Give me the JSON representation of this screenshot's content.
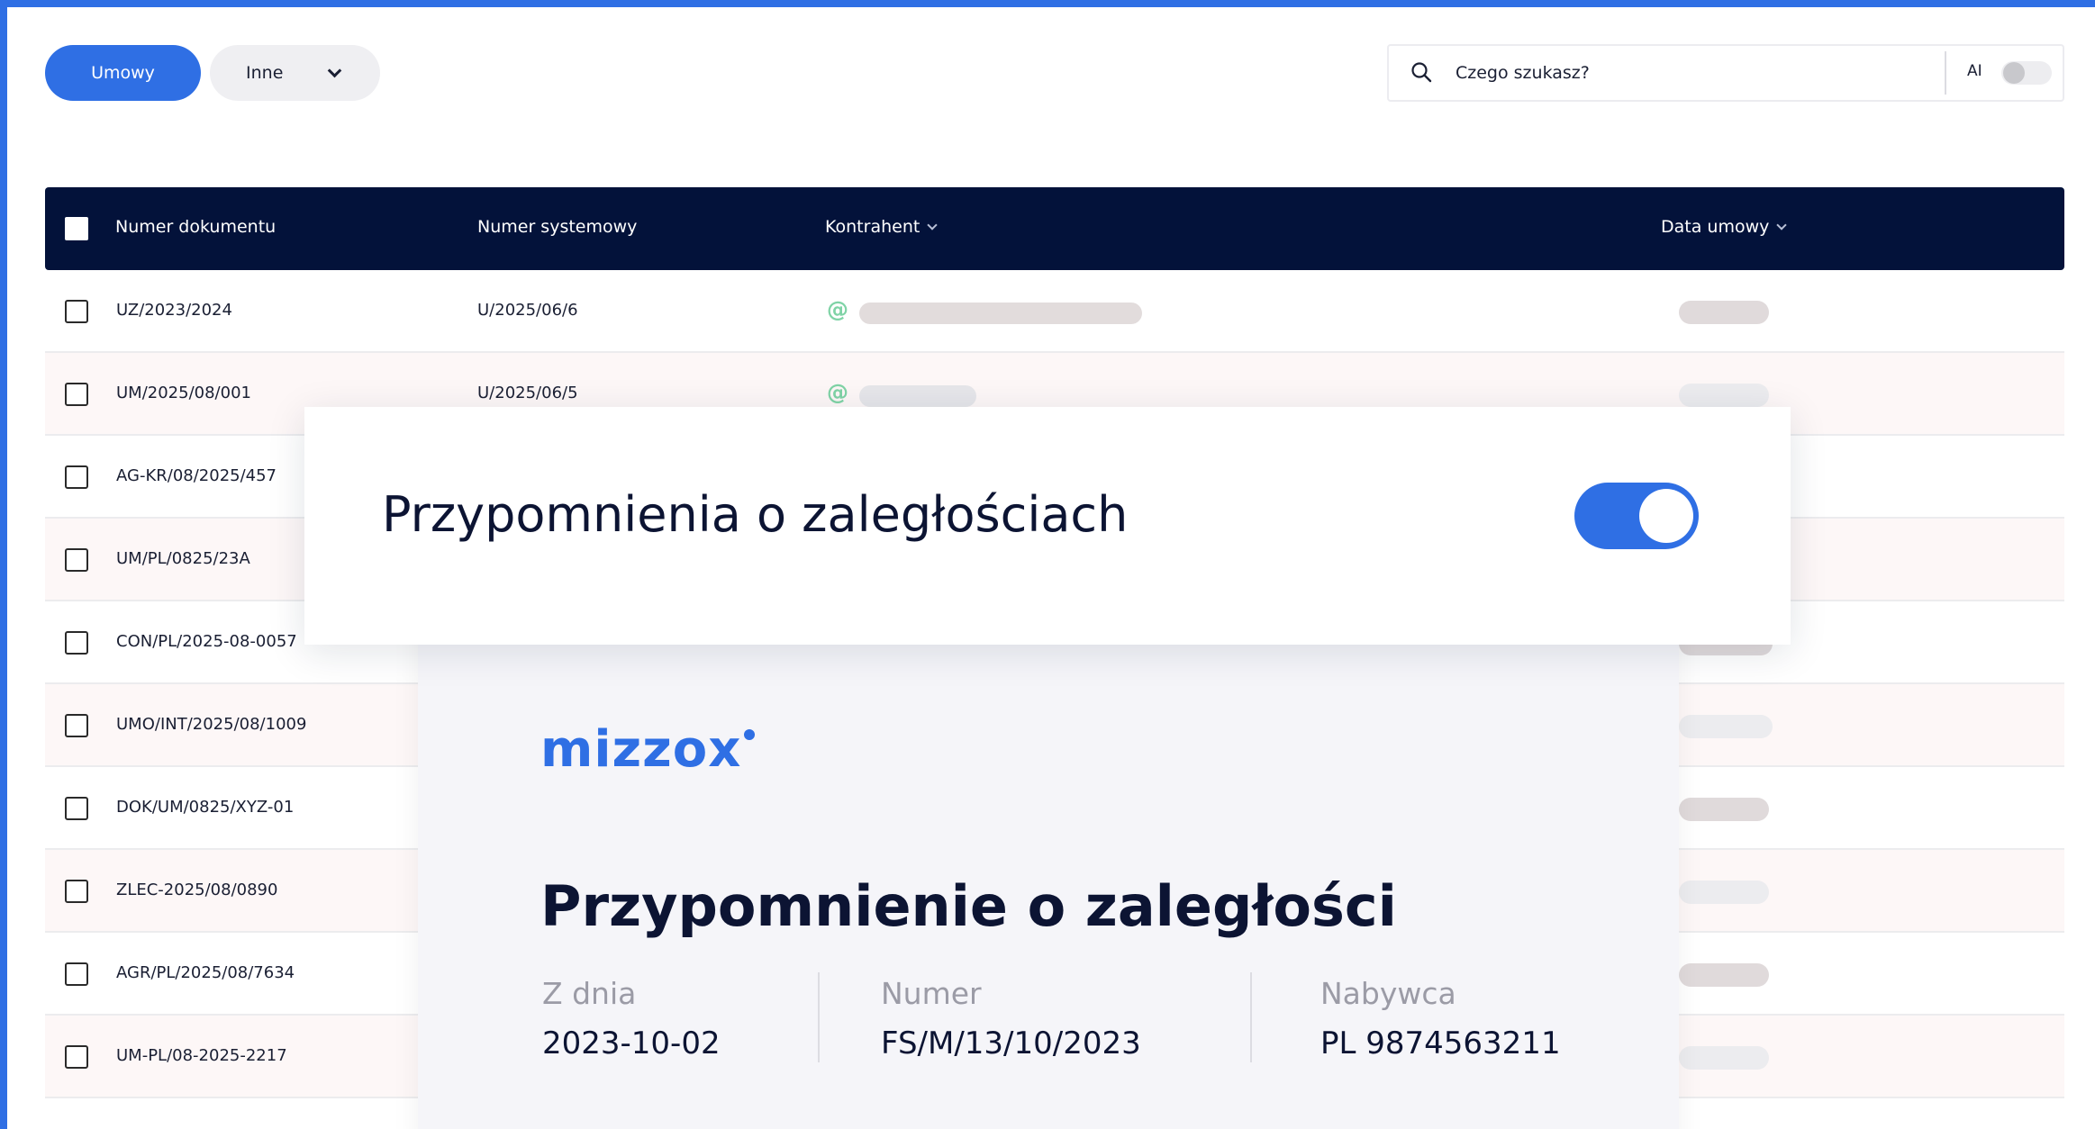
{
  "colors": {
    "accent": "#2f6fe4",
    "header_bg": "#03123a",
    "toggle_on": "#2f6fe4"
  },
  "toolbar": {
    "primary_tab": "Umowy",
    "secondary_tab": "Inne",
    "search_placeholder": "Czego szukasz?",
    "ai_label": "AI",
    "ai_enabled": false
  },
  "table": {
    "columns": {
      "doc": "Numer dokumentu",
      "sys": "Numer systemowy",
      "contractor": "Kontrahent",
      "date": "Data umowy"
    },
    "rows": [
      {
        "doc": "UZ/2023/2024",
        "sys": "U/2025/06/6"
      },
      {
        "doc": "UM/2025/08/001",
        "sys": "U/2025/06/5"
      },
      {
        "doc": "AG-KR/08/2025/457",
        "sys": ""
      },
      {
        "doc": "UM/PL/0825/23A",
        "sys": ""
      },
      {
        "doc": "CON/PL/2025-08-0057",
        "sys": ""
      },
      {
        "doc": "UMO/INT/2025/08/1009",
        "sys": ""
      },
      {
        "doc": "DOK/UM/0825/XYZ-01",
        "sys": ""
      },
      {
        "doc": "ZLEC-2025/08/0890",
        "sys": ""
      },
      {
        "doc": "AGR/PL/2025/08/7634",
        "sys": ""
      },
      {
        "doc": "UM-PL/08-2025-2217",
        "sys": ""
      }
    ]
  },
  "reminder_card": {
    "title": "Przypomnienia o zaległościach",
    "enabled": true
  },
  "document_preview": {
    "logo": "mizzox",
    "title": "Przypomnienie o zaległości",
    "date_label": "Z dnia",
    "date_value": "2023-10-02",
    "number_label": "Numer",
    "number_value": "FS/M/13/10/2023",
    "buyer_label": "Nabywca",
    "buyer_value": "PL 9874563211"
  }
}
